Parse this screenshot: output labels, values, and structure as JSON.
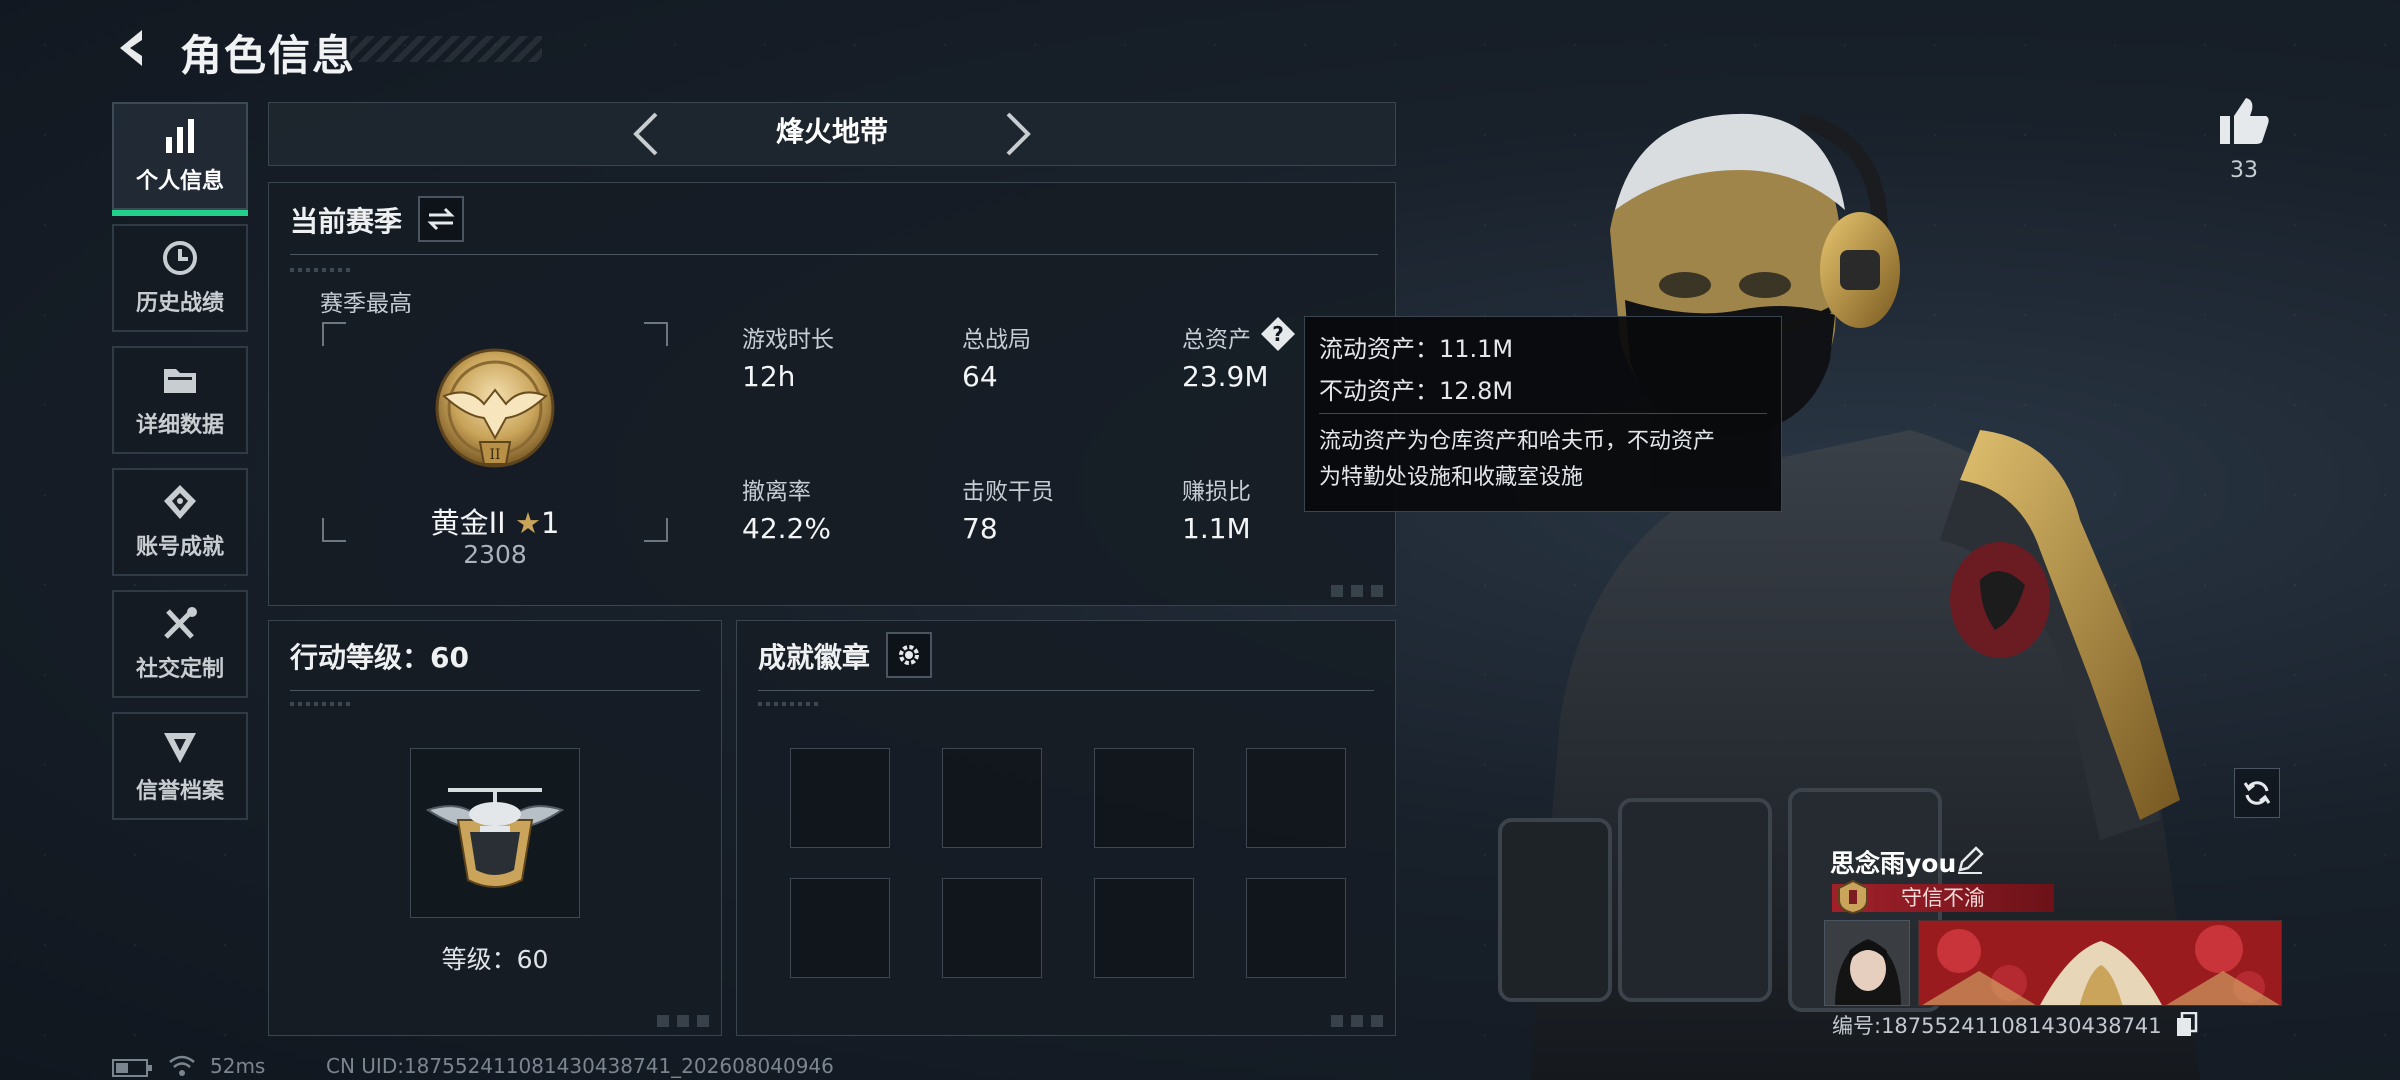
{
  "header": {
    "title": "角色信息"
  },
  "sidebar": {
    "items": [
      {
        "label": "个人信息"
      },
      {
        "label": "历史战绩"
      },
      {
        "label": "详细数据"
      },
      {
        "label": "账号成就"
      },
      {
        "label": "社交定制"
      },
      {
        "label": "信誉档案"
      }
    ]
  },
  "mode": {
    "title": "烽火地带"
  },
  "season": {
    "title": "当前赛季",
    "best_label": "赛季最高",
    "rank_name": "黄金II",
    "rank_stars": "1",
    "rank_score": "2308",
    "stats": [
      {
        "label": "游戏时长",
        "value": "12h"
      },
      {
        "label": "总战局",
        "value": "64"
      },
      {
        "label": "总资产",
        "value": "23.9M"
      },
      {
        "label": "撤离率",
        "value": "42.2%"
      },
      {
        "label": "击败干员",
        "value": "78"
      },
      {
        "label": "赚损比",
        "value": "1.1M"
      }
    ]
  },
  "tooltip": {
    "line1": "流动资产：11.1M",
    "line2": "不动资产：12.8M",
    "note1": "流动资产为仓库资产和哈夫币，不动资产",
    "note2": "为特勤处设施和收藏室设施"
  },
  "action_level": {
    "title": "行动等级：60",
    "level_label": "等级：60"
  },
  "achievements": {
    "title": "成就徽章"
  },
  "likes": {
    "count": "33"
  },
  "player": {
    "name": "思念雨you",
    "title": "守信不渝",
    "id_text": "编号:187552411081430438741"
  },
  "footer": {
    "ping": "52ms",
    "uid": "CN UID:187552411081430438741_202608040946"
  },
  "colors": {
    "accent": "#21d18a",
    "title_red": "#a1202a",
    "gold": "#c9a45a"
  }
}
